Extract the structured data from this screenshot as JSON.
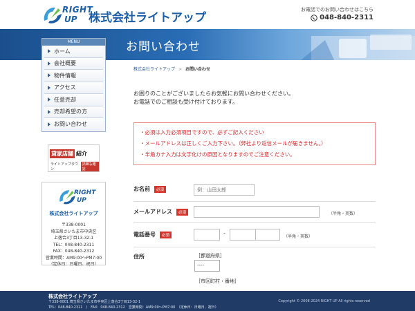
{
  "header": {
    "logo_right": "RIGHT",
    "logo_up": "UP",
    "company_name": "株式会社ライトアップ",
    "contact_note": "お電話でのお問い合わせはこちら",
    "phone": "048-840-2311"
  },
  "banner": {
    "title": "お問い合わせ"
  },
  "menu": {
    "heading": "MENU",
    "items": [
      {
        "label": "ホーム"
      },
      {
        "label": "会社概要"
      },
      {
        "label": "物件情報"
      },
      {
        "label": "アクセス"
      },
      {
        "label": "任意売却"
      },
      {
        "label": "売却希望の方"
      },
      {
        "label": "お問い合わせ"
      }
    ]
  },
  "promo": {
    "box": "貸家店舗",
    "label": "紹介",
    "sub": "ライトアップタウン",
    "badge": "詳細も確認"
  },
  "card": {
    "logo_right": "RIGHT",
    "logo_up": "UP",
    "name": "株式会社ライトアップ",
    "postal": "〒338-0001",
    "address1": "埼玉県さいたま市中央区",
    "address2": "上落合3丁目13-32-1",
    "tel": "TEL：048-840-2311",
    "fax": "FAX：048-840-2312",
    "hours": "営業時間：AM9:00～PM7:00",
    "holiday": "（定休日：日曜日、祝日）"
  },
  "breadcrumb": {
    "home": "株式会社ライトアップ",
    "separator": ">",
    "current": "お問い合わせ"
  },
  "intro": {
    "line1": "お困りのことがございましたらお気軽にお問い合わせください。",
    "line2": "お電話でのご相談も受け付けております。"
  },
  "notices": [
    "必須は入力必須項目ですので、必ずご記入ください",
    "メールアドレスは正しくご入力下さい。（弊社より返信メールが届きません。）",
    "半角カナ入力は文字化けの原因となりますのでご注意ください。"
  ],
  "form": {
    "required_badge": "必須",
    "name": {
      "label": "お名前",
      "placeholder": "例：山田太郎",
      "value": ""
    },
    "email": {
      "label": "メールアドレス",
      "value": "",
      "hint": "（半角・英数）"
    },
    "phone": {
      "label": "電話番号",
      "part1": "",
      "part2": "",
      "part3": "",
      "dash": "-",
      "hint": "（半角・英数）"
    },
    "address": {
      "label": "住所",
      "pref_label": "［都道府県］",
      "pref_value": "----",
      "city_label": "［市区町村・番地］"
    }
  },
  "footer": {
    "company": "株式会社ライトアップ",
    "address": "〒338-0001 埼玉県さいたま市中央区上落合3丁目13-32-1",
    "contact": "TEL：048-840-2311　/　FAX：048-840-2312　営業時間：AM9:00～PM7:00　（定休日：日曜日、祝日）",
    "copyright": "Copyright © 2008-2024 RIGHT UP All rights reserved"
  }
}
